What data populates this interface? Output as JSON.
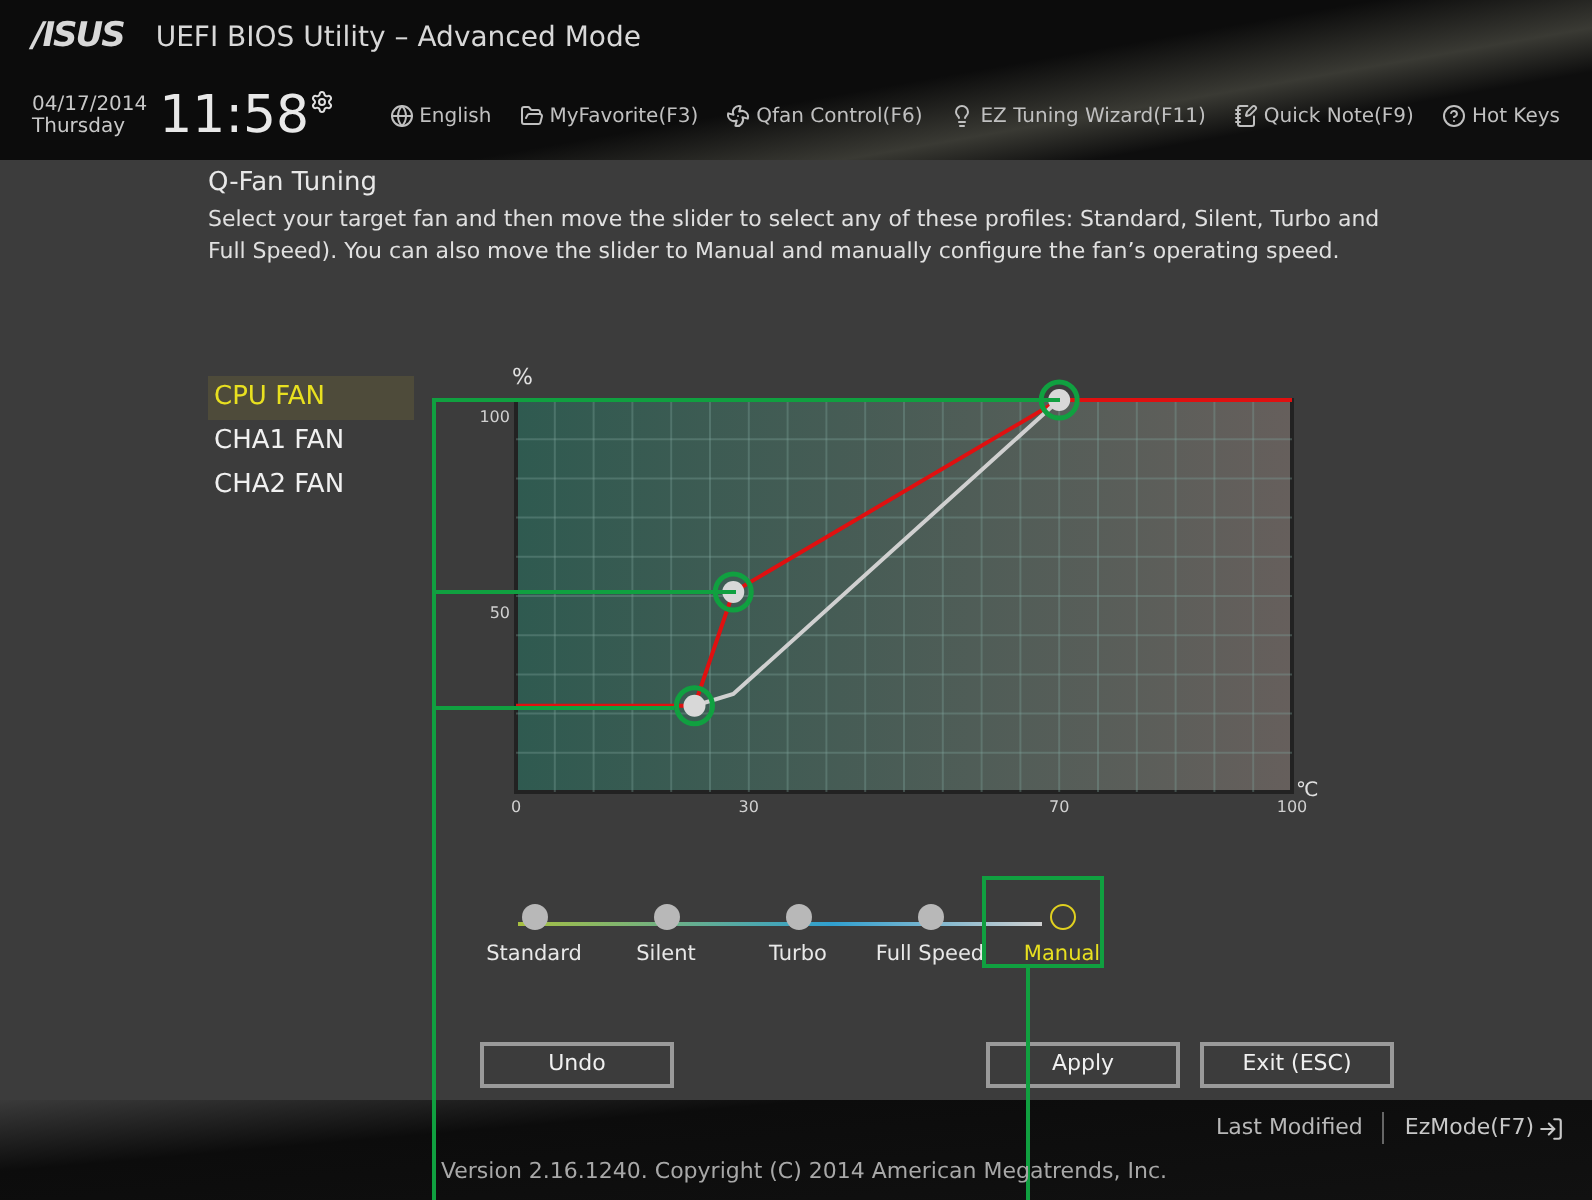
{
  "header": {
    "logo": "/ISUS",
    "title": "UEFI BIOS Utility – Advanced Mode",
    "date": "04/17/2014",
    "day": "Thursday",
    "time": "11:58"
  },
  "nav": [
    {
      "kind": "globe",
      "label": "English"
    },
    {
      "kind": "folder",
      "label": "MyFavorite(F3)"
    },
    {
      "kind": "fan",
      "label": "Qfan Control(F6)"
    },
    {
      "kind": "bulb",
      "label": "EZ Tuning Wizard(F11)"
    },
    {
      "kind": "note",
      "label": "Quick Note(F9)"
    },
    {
      "kind": "help",
      "label": "Hot Keys"
    }
  ],
  "section": {
    "title": "Q-Fan Tuning",
    "description": "Select your target fan and then move the slider to select any of these profiles: Standard, Silent, Turbo and Full Speed). You can also move the slider to Manual and manually configure the fan’s operating speed."
  },
  "fans": [
    {
      "label": "CPU FAN",
      "selected": true
    },
    {
      "label": "CHA1 FAN",
      "selected": false
    },
    {
      "label": "CHA2 FAN",
      "selected": false
    }
  ],
  "fan_curve": {
    "chart_data": {
      "type": "line",
      "xlabel": "℃",
      "ylabel": "%",
      "x": [
        0,
        23,
        28,
        70,
        100
      ],
      "series": [
        {
          "color": "#e01010",
          "values": [
            22,
            22,
            51,
            100,
            100
          ]
        },
        {
          "color": "#d0d0d0",
          "values": [
            null,
            22,
            25,
            100,
            null
          ]
        }
      ],
      "ylim": [
        0,
        100
      ],
      "grid": true,
      "xlim": [
        0,
        100
      ],
      "xticks": [
        0,
        30,
        70,
        100
      ],
      "yticks": [
        50,
        100
      ]
    }
  },
  "profiles": [
    {
      "label": "Standard",
      "selected": false
    },
    {
      "label": "Silent",
      "selected": false
    },
    {
      "label": "Turbo",
      "selected": false
    },
    {
      "label": "Full Speed",
      "selected": false
    },
    {
      "label": "Manual",
      "selected": true
    }
  ],
  "buttons": {
    "undo": "Undo",
    "apply": "Apply",
    "exit": "Exit (ESC)"
  },
  "footer": {
    "last_modified": "Last Modified",
    "ez_mode": "EzMode(F7)",
    "version": "Version 2.16.1240. Copyright (C) 2014 American Megatrends, Inc."
  }
}
